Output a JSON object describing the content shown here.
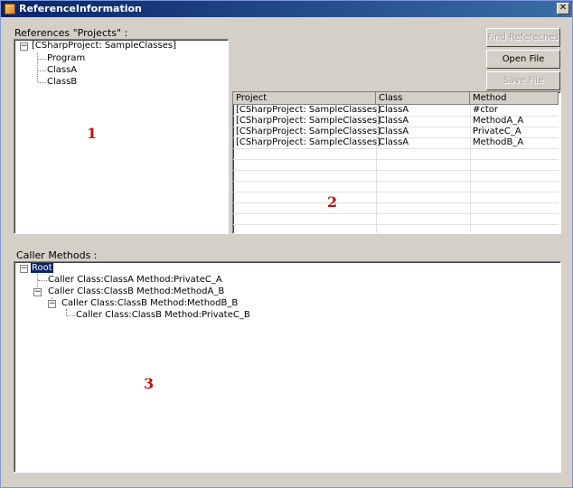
{
  "window": {
    "title": "ReferenceInformation",
    "close_glyph": "✕"
  },
  "references": {
    "label": "References \"Projects\" :",
    "tree": {
      "root": "[CSharpProject: SampleClasses]",
      "children": [
        "Program",
        "ClassA",
        "ClassB"
      ]
    }
  },
  "buttons": {
    "find_references": "Find Referecnes",
    "open_file": "Open File",
    "save_file": "Save File"
  },
  "grid": {
    "columns": [
      "Project",
      "Class",
      "Method"
    ],
    "rows": [
      [
        "[CSharpProject: SampleClasses]",
        "ClassA",
        "#ctor"
      ],
      [
        "[CSharpProject: SampleClasses]",
        "ClassA",
        "MethodA_A"
      ],
      [
        "[CSharpProject: SampleClasses]",
        "ClassA",
        "PrivateC_A"
      ],
      [
        "[CSharpProject: SampleClasses]",
        "ClassA",
        "MethodB_A"
      ]
    ]
  },
  "callers": {
    "label": "Caller Methods :",
    "tree": {
      "root": "Root",
      "nodes": [
        "Caller Class:ClassA Method:PrivateC_A",
        "Caller Class:ClassB Method:MethodA_B",
        "Caller Class:ClassB Method:MethodB_B",
        "Caller Class:ClassB Method:PrivateC_B"
      ]
    }
  },
  "annotations": {
    "one": "1",
    "two": "2",
    "three": "3"
  }
}
